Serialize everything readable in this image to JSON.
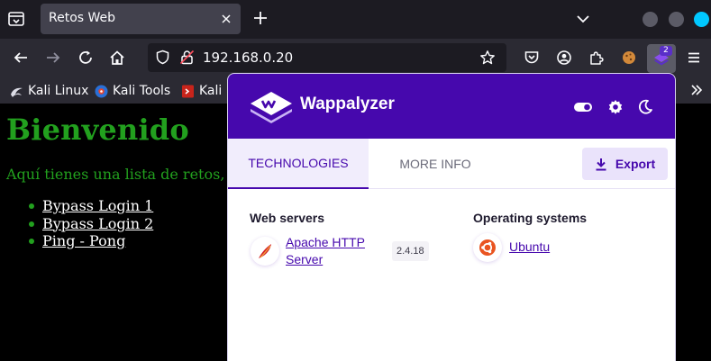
{
  "browser": {
    "tab_title": "Retos Web",
    "url": "192.168.0.20",
    "extension_badge": "2",
    "bookmarks": [
      {
        "label": "Kali Linux",
        "icon": "kali-dragon-icon"
      },
      {
        "label": "Kali Tools",
        "icon": "kali-tools-icon"
      },
      {
        "label": "Kali D",
        "icon": "exploit-db-icon"
      }
    ],
    "colors": {
      "tabbar": "#1c1b22",
      "toolbar": "#2b2a33",
      "accent": "#00c8ff"
    }
  },
  "page": {
    "heading": "Bienvenido",
    "intro": "Aquí tienes una lista de retos,",
    "links": [
      "Bypass Login 1",
      "Bypass Login 2",
      "Ping - Pong"
    ],
    "colors": {
      "text": "#22a01e",
      "link": "#ffffff",
      "background": "#000000"
    }
  },
  "wappalyzer": {
    "title": "Wappalyzer",
    "tabs": [
      "TECHNOLOGIES",
      "MORE INFO"
    ],
    "active_tab": "TECHNOLOGIES",
    "export_label": "Export",
    "categories": [
      {
        "name": "Web servers",
        "items": [
          {
            "name_line1": "Apache HTTP",
            "name_line2": "Server",
            "version": "2.4.18",
            "icon": "apache-feather-icon"
          }
        ]
      },
      {
        "name": "Operating systems",
        "items": [
          {
            "name": "Ubuntu",
            "icon": "ubuntu-icon"
          }
        ]
      }
    ],
    "colors": {
      "brand": "#4608ad",
      "tab_bg": "#f1edfc",
      "export_bg": "#eae3fb"
    }
  }
}
